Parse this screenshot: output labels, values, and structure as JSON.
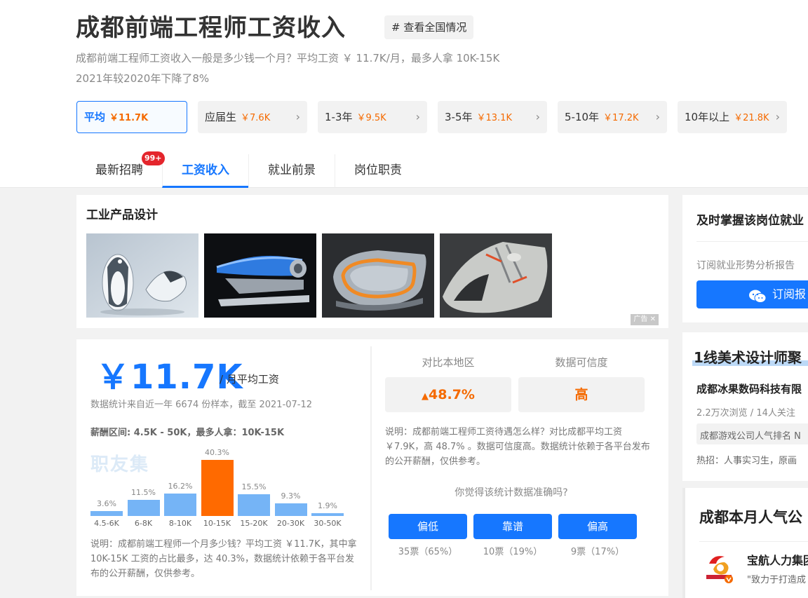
{
  "page": {
    "title": "成都前端工程师工资收入",
    "national_chip": "# 查看全国情况",
    "summary_line1": "成都前端工程师工资收入一般是多少钱一个月？平均工资 ￥ 11.7K/月，最多人拿 10K-15K",
    "summary_line2": "2021年较2020年下降了8%"
  },
  "levels": [
    {
      "label": "平均",
      "value": "￥11.7K",
      "active": true
    },
    {
      "label": "应届生",
      "value": "￥7.6K"
    },
    {
      "label": "1-3年",
      "value": "￥9.5K"
    },
    {
      "label": "3-5年",
      "value": "￥13.1K"
    },
    {
      "label": "5-10年",
      "value": "￥17.2K"
    },
    {
      "label": "10年以上",
      "value": "￥21.8K"
    }
  ],
  "tabs": [
    {
      "label": "最新招聘",
      "badge": "99+"
    },
    {
      "label": "工资收入",
      "active": true
    },
    {
      "label": "就业前景"
    },
    {
      "label": "岗位职责"
    }
  ],
  "ad": {
    "title": "工业产品设计",
    "tag": "广告",
    "close": "✕"
  },
  "salary": {
    "big_value": "￥11.7K",
    "unit_label": "/ 月平均工资",
    "stat_line": "数据统计来自近一年 6674 份样本，截至 2021-07-12",
    "range_line": "薪酬区间: 4.5K - 50K，最多人拿：10K-15K",
    "watermark": "职友集",
    "note": "说明：成都前端工程师一个月多少钱？平均工资 ￥11.7K，其中拿 10K-15K 工资的占比最多，达 40.3%，数据统计依赖于各平台发布的公开薪酬，仅供参考。"
  },
  "chart_data": {
    "type": "bar",
    "categories": [
      "4.5-6K",
      "6-8K",
      "8-10K",
      "10-15K",
      "15-20K",
      "20-30K",
      "30-50K"
    ],
    "values": [
      3.6,
      11.5,
      16.2,
      40.3,
      15.5,
      9.3,
      1.9
    ],
    "value_labels": [
      "3.6%",
      "11.5%",
      "16.2%",
      "40.3%",
      "15.5%",
      "9.3%",
      "1.9%"
    ],
    "highlight_index": 3,
    "title": "",
    "xlabel": "",
    "ylabel": ""
  },
  "compare": {
    "region_label": "对比本地区",
    "region_value": "48.7%",
    "trust_label": "数据可信度",
    "trust_value": "高",
    "note": "说明：成都前端工程师工资待遇怎么样？对比成都平均工资 ￥7.9K，高 48.7% 。数据可信度高。数据统计依赖于各平台发布的公开薪酬，仅供参考。",
    "ask": "你觉得该统计数据准确吗?",
    "votes": [
      {
        "label": "偏低",
        "count": "35票（65%）"
      },
      {
        "label": "靠谱",
        "count": "10票（19%）"
      },
      {
        "label": "偏高",
        "count": "9票（17%）"
      }
    ]
  },
  "right": {
    "sub_title": "及时掌握该岗位就业",
    "sub_text": "订阅就业形势分析报告",
    "sub_button": "订阅报告",
    "promo_title": "1线美术设计师聚",
    "company": "成都冰果数码科技有限",
    "company_meta": "2.2万次浏览 / 14人关注",
    "rank_link": "成都游戏公司人气排名 N",
    "hot": "热招：人事实习生，原画",
    "popular_title": "成都本月人气公",
    "pop_company": "宝航人力集团",
    "pop_slogan": "\"致力于打造成"
  },
  "colors": {
    "accent": "#1677ff",
    "highlight": "#ff6a00",
    "bar": "#75b4f6",
    "badge": "#e4252c"
  }
}
